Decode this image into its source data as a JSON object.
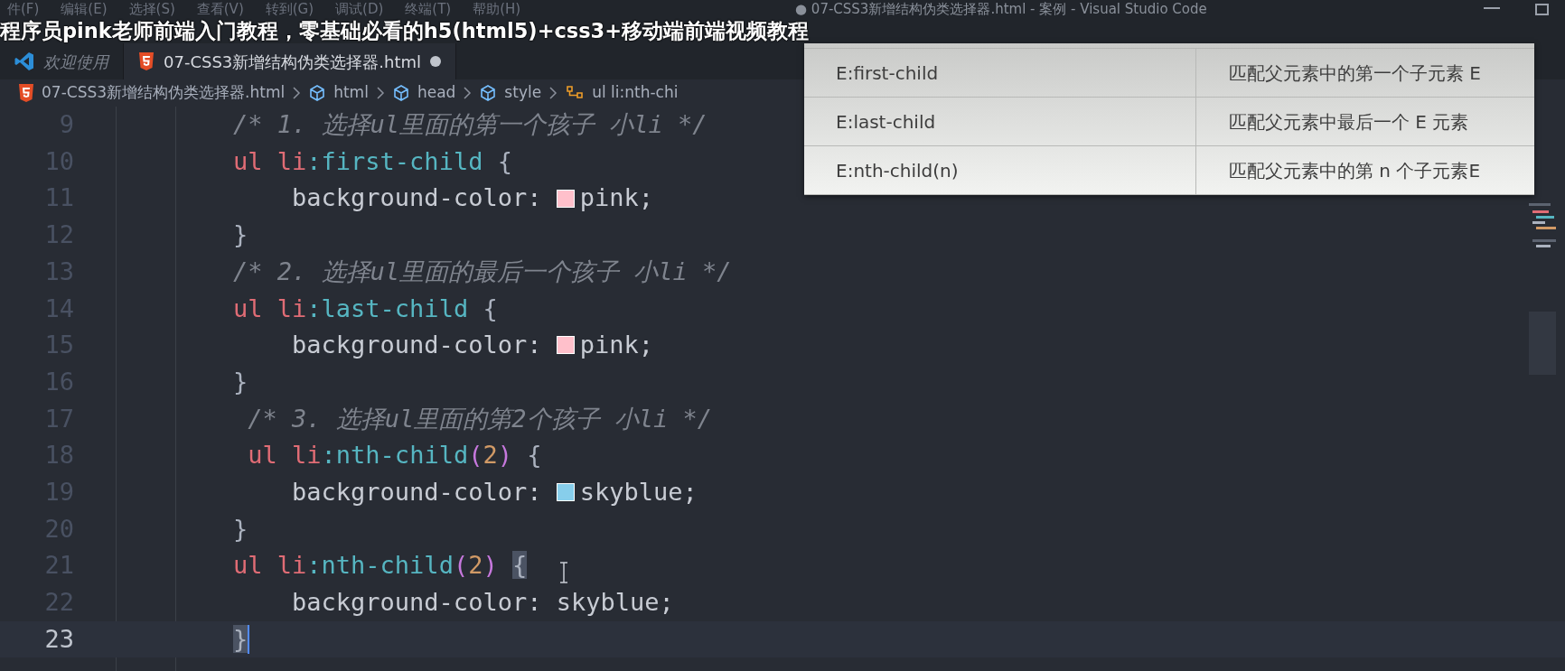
{
  "window": {
    "title": "● 07-CSS3新增结构伪类选择器.html - 案例 - Visual Studio Code"
  },
  "menu": [
    "件(F)",
    "编辑(E)",
    "选择(S)",
    "查看(V)",
    "转到(G)",
    "调试(D)",
    "终端(T)",
    "帮助(H)"
  ],
  "video_caption": "程序员pink老师前端入门教程，零基础必看的h5(html5)+css3+移动端前端视频教程",
  "tabs": [
    {
      "label": "欢迎使用",
      "kind": "vscode",
      "selected": false,
      "preview": true,
      "modified": false
    },
    {
      "label": "07-CSS3新增结构伪类选择器.html",
      "kind": "html5",
      "selected": true,
      "preview": false,
      "modified": true
    }
  ],
  "breadcrumbs": [
    {
      "label": "07-CSS3新增结构伪类选择器.html",
      "kind": "html5"
    },
    {
      "label": "html",
      "kind": "cube"
    },
    {
      "label": "head",
      "kind": "cube"
    },
    {
      "label": "style",
      "kind": "cube"
    },
    {
      "label": "ul li:nth-chi",
      "kind": "selector"
    }
  ],
  "lines": [
    {
      "number": "9",
      "current": false,
      "tokens": [
        {
          "kind": "comment",
          "text": "        /* 1. 选择ul里面的第一个孩子 小li */"
        }
      ]
    },
    {
      "number": "10",
      "current": false,
      "tokens": [
        {
          "kind": "tag",
          "text": "        ul "
        },
        {
          "kind": "tag",
          "text": "li"
        },
        {
          "kind": "pseudo",
          "text": ":first-child"
        },
        {
          "kind": "punct",
          "text": " {"
        }
      ]
    },
    {
      "number": "11",
      "current": false,
      "tokens": [
        {
          "kind": "property",
          "text": "            background-color: "
        },
        {
          "kind": "swatch",
          "color": "#ffc0cb"
        },
        {
          "kind": "property",
          "text": "pink;"
        }
      ]
    },
    {
      "number": "12",
      "current": false,
      "tokens": [
        {
          "kind": "punct",
          "text": "        }"
        }
      ]
    },
    {
      "number": "13",
      "current": false,
      "tokens": [
        {
          "kind": "comment",
          "text": "        /* 2. 选择ul里面的最后一个孩子 小li */"
        }
      ]
    },
    {
      "number": "14",
      "current": false,
      "tokens": [
        {
          "kind": "tag",
          "text": "        ul "
        },
        {
          "kind": "tag",
          "text": "li"
        },
        {
          "kind": "pseudo",
          "text": ":last-child"
        },
        {
          "kind": "punct",
          "text": " {"
        }
      ]
    },
    {
      "number": "15",
      "current": false,
      "tokens": [
        {
          "kind": "property",
          "text": "            background-color: "
        },
        {
          "kind": "swatch",
          "color": "#ffc0cb"
        },
        {
          "kind": "property",
          "text": "pink;"
        }
      ]
    },
    {
      "number": "16",
      "current": false,
      "tokens": [
        {
          "kind": "punct",
          "text": "        }"
        }
      ]
    },
    {
      "number": "17",
      "current": false,
      "tokens": [
        {
          "kind": "comment",
          "text": "         /* 3. 选择ul里面的第2个孩子 小li */"
        }
      ]
    },
    {
      "number": "18",
      "current": false,
      "tokens": [
        {
          "kind": "tag",
          "text": "         ul "
        },
        {
          "kind": "tag",
          "text": "li"
        },
        {
          "kind": "pseudo",
          "text": ":nth-child"
        },
        {
          "kind": "paren",
          "text": "("
        },
        {
          "kind": "number",
          "text": "2"
        },
        {
          "kind": "paren",
          "text": ")"
        },
        {
          "kind": "punct",
          "text": " {"
        }
      ]
    },
    {
      "number": "19",
      "current": false,
      "tokens": [
        {
          "kind": "property",
          "text": "            background-color: "
        },
        {
          "kind": "swatch",
          "color": "#87ceeb"
        },
        {
          "kind": "property",
          "text": "skyblue;"
        }
      ]
    },
    {
      "number": "20",
      "current": false,
      "tokens": [
        {
          "kind": "punct",
          "text": "        }"
        }
      ]
    },
    {
      "number": "21",
      "current": false,
      "tokens": [
        {
          "kind": "tag",
          "text": "        ul "
        },
        {
          "kind": "tag",
          "text": "li"
        },
        {
          "kind": "pseudo",
          "text": ":nth-child"
        },
        {
          "kind": "paren",
          "text": "("
        },
        {
          "kind": "number",
          "text": "2"
        },
        {
          "kind": "paren",
          "text": ") "
        },
        {
          "kind": "bracket-match",
          "text": "{"
        }
      ]
    },
    {
      "number": "22",
      "current": false,
      "tokens": [
        {
          "kind": "property",
          "text": "            background-color: skyblue;"
        }
      ]
    },
    {
      "number": "23",
      "current": true,
      "tokens": [
        {
          "kind": "bracket-match",
          "text": "        }"
        }
      ]
    }
  ],
  "popup_table": {
    "rows": [
      {
        "selector": "E:first-child",
        "description": "匹配父元素中的第一个子元素 E"
      },
      {
        "selector": "E:last-child",
        "description": "匹配父元素中最后一个 E 元素"
      },
      {
        "selector": "E:nth-child(n)",
        "description": "匹配父元素中的第 n 个子元素E"
      }
    ]
  }
}
